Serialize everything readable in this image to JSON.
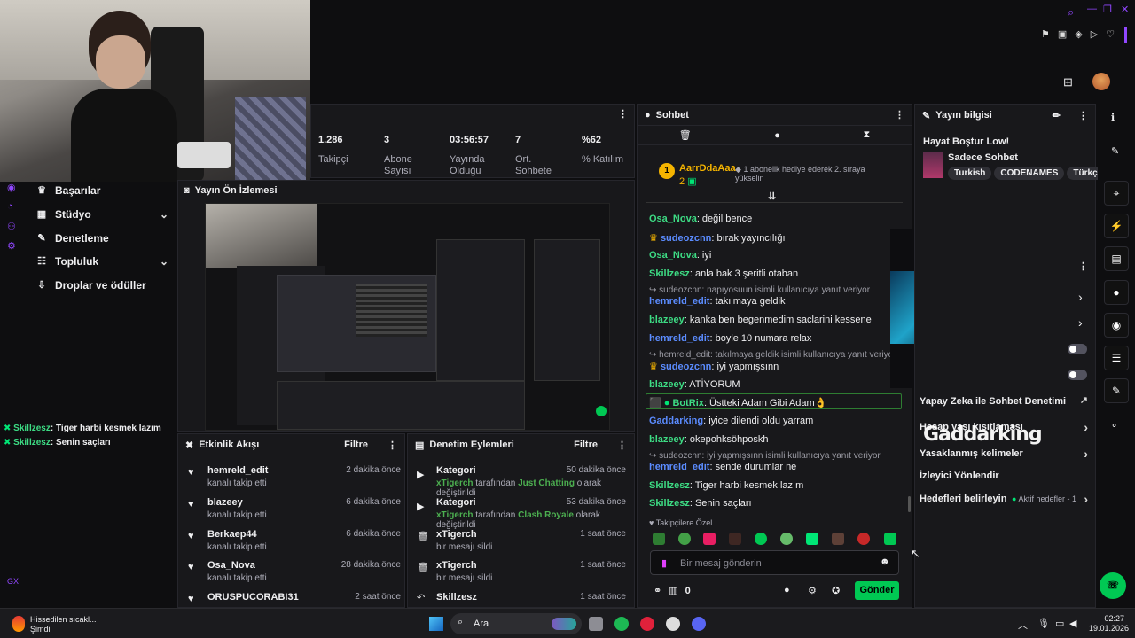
{
  "colors": {
    "accent": "#00e676",
    "bg": "#0e0e10",
    "panel": "#18181b",
    "purple": "#9147ff",
    "send": "#00c853"
  },
  "sidebar": {
    "items": [
      {
        "label": "Başarılar",
        "icon": "trophy-icon"
      },
      {
        "label": "Stüdyo",
        "icon": "studio-icon",
        "expandable": true
      },
      {
        "label": "Denetleme",
        "icon": "wrench-icon"
      },
      {
        "label": "Topluluk",
        "icon": "community-icon",
        "expandable": true
      },
      {
        "label": "Droplar ve ödüller",
        "icon": "drops-icon"
      }
    ]
  },
  "overlay_chat": [
    {
      "user": "Skillzesz",
      "text": ": Tiger harbi kesmek lazım"
    },
    {
      "user": "Skillzesz",
      "text": ": Senin saçları"
    }
  ],
  "stats": [
    {
      "value": "1.286",
      "label": "Takipçi"
    },
    {
      "value": "3",
      "label": "Abone Sayısı"
    },
    {
      "value": "03:56:57",
      "label": "Yayında Olduğu"
    },
    {
      "value": "7",
      "label": "Ort. Sohbete"
    },
    {
      "value": "%62",
      "label": "% Katılım"
    }
  ],
  "preview": {
    "title": "Yayın Ön İzlemesi"
  },
  "activity": {
    "title": "Etkinlik Akışı",
    "filter": "Filtre",
    "rows": [
      {
        "name": "hemreld_edit",
        "sub": "kanalı takip etti",
        "time": "2 dakika önce"
      },
      {
        "name": "blazeey",
        "sub": "kanalı takip etti",
        "time": "6 dakika önce"
      },
      {
        "name": "Berkaep44",
        "sub": "kanalı takip etti",
        "time": "6 dakika önce"
      },
      {
        "name": "Osa_Nova",
        "sub": "kanalı takip etti",
        "time": "28 dakika önce"
      },
      {
        "name": "ORUSPUCORABI31",
        "sub": "",
        "time": "2 saat önce"
      }
    ]
  },
  "moderation": {
    "title": "Denetim Eylemleri",
    "filter": "Filtre",
    "rows": [
      {
        "name": "Kategori",
        "actor": "xTigerch",
        "mid": " tarafından ",
        "value": "Just Chatting",
        "tail": " olarak değiştirildi",
        "time": "50 dakika önce"
      },
      {
        "name": "Kategori",
        "actor": "xTigerch",
        "mid": " tarafından ",
        "value": "Clash Royale",
        "tail": " olarak değiştirildi",
        "time": "53 dakika önce"
      },
      {
        "name": "xTigerch",
        "sub": "bir mesajı sildi",
        "time": "1 saat önce"
      },
      {
        "name": "xTigerch",
        "sub": "bir mesajı sildi",
        "time": "1 saat önce"
      },
      {
        "name": "Skillzesz",
        "sub": "",
        "time": "1 saat önce"
      }
    ]
  },
  "chat": {
    "title": "Sohbet",
    "gift": {
      "user": "AarrDdaAaa",
      "count": "2",
      "text": "1 abonelik hediye ederek 2. sıraya yükselin"
    },
    "messages": [
      {
        "user": "Osa_Nova",
        "text": ": değil bence"
      },
      {
        "user": "sudeozcnn",
        "text": ": bırak yayıncılığı"
      },
      {
        "user": "Osa_Nova",
        "text": ": iyi"
      },
      {
        "user": "Skillzesz",
        "text": ": anla bak 3 şeritli otaban"
      },
      {
        "reply": "sudeozcnn: napıyosuun isimli kullanıcıya yanıt veriyor"
      },
      {
        "user": "hemreld_edit",
        "text": ": takılmaya geldik"
      },
      {
        "user": "blazeey",
        "text": ": kanka ben begenmedim saclarini kessene"
      },
      {
        "user": "hemreld_edit",
        "text": ": boyle 10 numara relax"
      },
      {
        "reply": "hemreld_edit: takılmaya geldik isimli kullanıcıya yanıt veriyor"
      },
      {
        "user": "sudeozcnn",
        "text": ": iyi yapmışsınn"
      },
      {
        "user": "blazeey",
        "text": ": ATİYORUM"
      },
      {
        "user": "BotRix",
        "text": ": Üstteki Adam Gibi Adam👌"
      },
      {
        "user": "Gaddarking",
        "text": ": iyice dilendi oldu yarram"
      },
      {
        "user": "blazeey",
        "text": ": okepohksöhposkh"
      },
      {
        "reply": "sudeozcnn: iyi yapmışsınn isimli kullanıcıya yanıt veriyor"
      },
      {
        "user": "hemreld_edit",
        "text": ": sende durumlar ne"
      },
      {
        "user": "Skillzesz",
        "text": ": Tiger harbi kesmek lazım"
      },
      {
        "user": "Skillzesz",
        "text": ": Senin saçları"
      }
    ],
    "emote_section": "Takipçilere Özel",
    "input_placeholder": "Bir mesaj gönderin",
    "points": "0",
    "send_label": "Gönder"
  },
  "info": {
    "title": "Yayın bilgisi",
    "stream_title": "Hayat Boştur Low!",
    "category": "Sadece Sohbet",
    "tags": [
      "Turkish",
      "CODENAMES",
      "Türkçe"
    ]
  },
  "settings_list": [
    {
      "label": "Yapay Zeka ile Sohbet Denetimi"
    },
    {
      "label": "Hesap yaşı kısıtlaması"
    },
    {
      "label": "Yasaklanmış kelimeler"
    },
    {
      "label": "İzleyici Yönlendir"
    },
    {
      "label": "Hedefleri belirleyin",
      "extra": "Aktif hedefler - 1"
    }
  ],
  "watermark": "Gaddarking",
  "taskbar": {
    "weather_title": "Hissedilen sıcakl...",
    "weather_sub": "Şimdi",
    "search": "Ara",
    "time": "02:27",
    "date": "19.01.2026"
  }
}
